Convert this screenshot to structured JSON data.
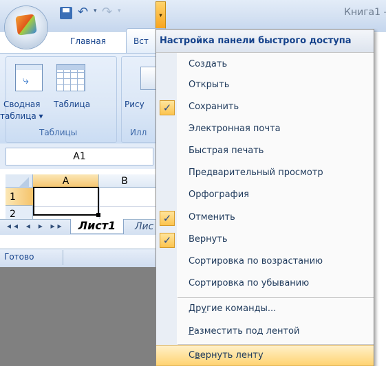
{
  "window": {
    "title": "Книга1 -"
  },
  "ribbon": {
    "tabs": [
      "Главная",
      "Вст"
    ],
    "buttons": {
      "pivot_line1": "Сводная",
      "pivot_line2": "таблица ▾",
      "table": "Таблица",
      "picture": "Рису"
    },
    "groups": {
      "tables": "Таблицы",
      "illustrations": "Илл"
    }
  },
  "formula": {
    "namebox": "A1"
  },
  "grid": {
    "columns": [
      "A",
      "B"
    ],
    "rows": [
      "1",
      "2"
    ]
  },
  "sheets": {
    "nav": "◂◂ ◂ ▸ ▸▸",
    "tabs": [
      "Лист1",
      "Лис"
    ]
  },
  "status": {
    "text": "Готово"
  },
  "menu": {
    "header": "Настройка панели быстрого доступа",
    "items": [
      {
        "label": "Создать",
        "checked": false
      },
      {
        "label": "Открыть",
        "checked": false
      },
      {
        "label": "Сохранить",
        "checked": true
      },
      {
        "label": "Электронная почта",
        "checked": false
      },
      {
        "label": "Быстрая печать",
        "checked": false
      },
      {
        "label": "Предварительный просмотр",
        "checked": false
      },
      {
        "label": "Орфография",
        "checked": false
      },
      {
        "label": "Отменить",
        "checked": true
      },
      {
        "label": "Вернуть",
        "checked": true
      },
      {
        "label": "Сортировка по возрастанию",
        "checked": false
      },
      {
        "label": "Сортировка по убыванию",
        "checked": false
      }
    ],
    "more_commands": {
      "pre": "Др",
      "u": "у",
      "post": "гие команды..."
    },
    "below_ribbon": {
      "pre": "",
      "u": "Р",
      "post": "азместить под лентой"
    },
    "collapse_ribbon": {
      "pre": "С",
      "u": "в",
      "post": "ернуть ленту"
    },
    "check_glyph": "✓"
  },
  "icons": {
    "office": "office-button-icon",
    "save": "save-icon",
    "undo": "undo-icon",
    "redo": "redo-icon",
    "customize": "customize-qat-icon"
  },
  "colors": {
    "highlight": "#ffd372",
    "accent": "#15428b"
  }
}
